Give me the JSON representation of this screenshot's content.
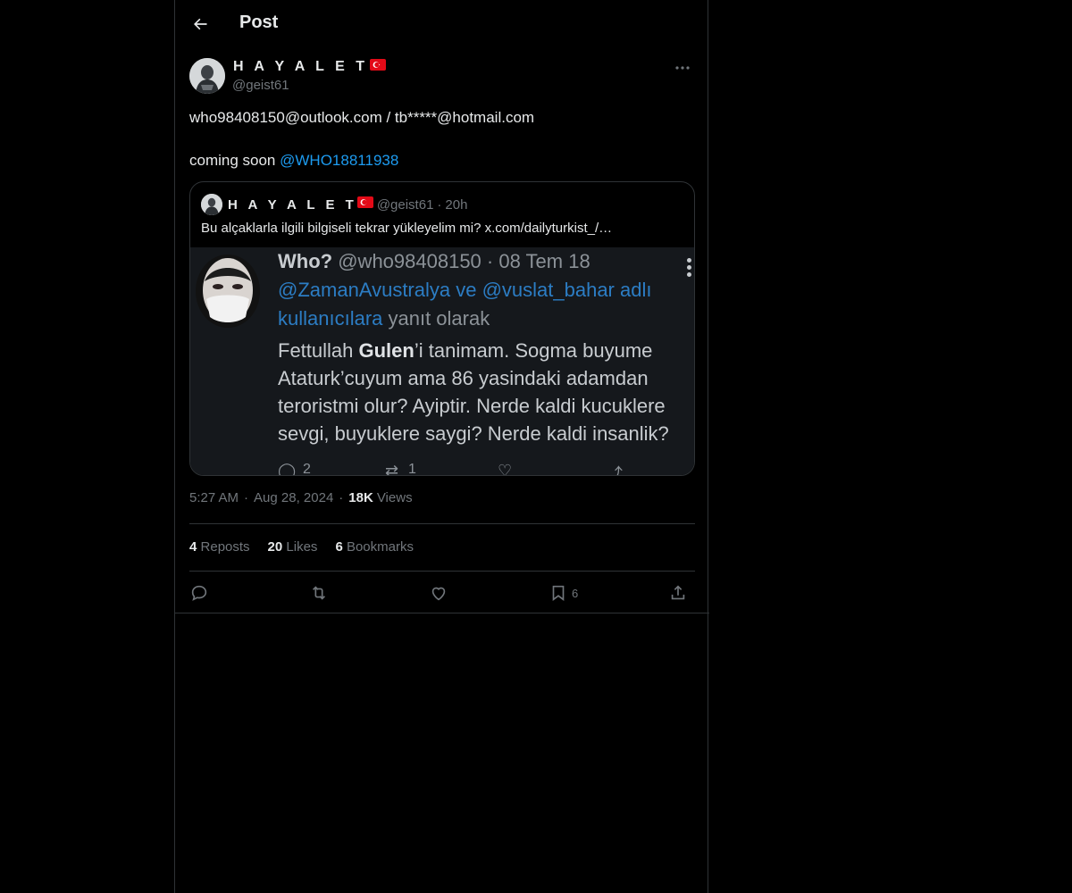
{
  "header": {
    "title": "Post"
  },
  "post": {
    "author": {
      "display_name": "H A Y A L E T",
      "flag": "🇹🇷",
      "handle": "@geist61"
    },
    "text_line1": "who98408150@outlook.com / tb*****@hotmail.com",
    "text_line2_prefix": "coming soon ",
    "text_line2_mention": "@WHO18811938",
    "quote": {
      "display_name": "H A Y A L E T",
      "handle": "@geist61",
      "dot": "·",
      "time": "20h",
      "text": "Bu alçaklarla ilgili bilgiseli tekrar yükleyelim mi?  x.com/dailyturkist_/…",
      "screenshot": {
        "name": "Who?",
        "handle_date": "@who98408150 · 08 Tem 18",
        "reply_line1": "@ZamanAvustralya ve @vuslat_bahar adlı",
        "reply_line2_link": "kullanıcılara",
        "reply_line2_rest": " yanıt olarak",
        "body_line1_a": "Fettullah ",
        "body_line1_bold": "Gulen",
        "body_line1_b": "’i tanimam. Sogma buyume",
        "body_line2": "Ataturk’cuyum ama 86 yasindaki adamdan",
        "body_line3": "teroristmi olur? Ayiptir. Nerde kaldi kucuklere",
        "body_line4": "sevgi, buyuklere saygi? Nerde kaldi insanlik?",
        "reply_count": "2",
        "repost_count": "1"
      }
    },
    "meta": {
      "time": "5:27 AM",
      "dot": "·",
      "date": "Aug 28, 2024",
      "views_count": "18K",
      "views_label": "Views"
    },
    "stats": {
      "reposts_count": "4",
      "reposts_label": "Reposts",
      "likes_count": "20",
      "likes_label": "Likes",
      "bookmarks_count": "6",
      "bookmarks_label": "Bookmarks"
    },
    "actions": {
      "bookmark_count": "6"
    }
  },
  "colors": {
    "background": "#000000",
    "text": "#e7e9ea",
    "muted": "#71767b",
    "accent": "#1d9bf0",
    "border": "#2f3336"
  },
  "icons": [
    "back-arrow-icon",
    "more-icon",
    "reply-icon",
    "repost-icon",
    "like-icon",
    "bookmark-icon",
    "share-icon"
  ]
}
